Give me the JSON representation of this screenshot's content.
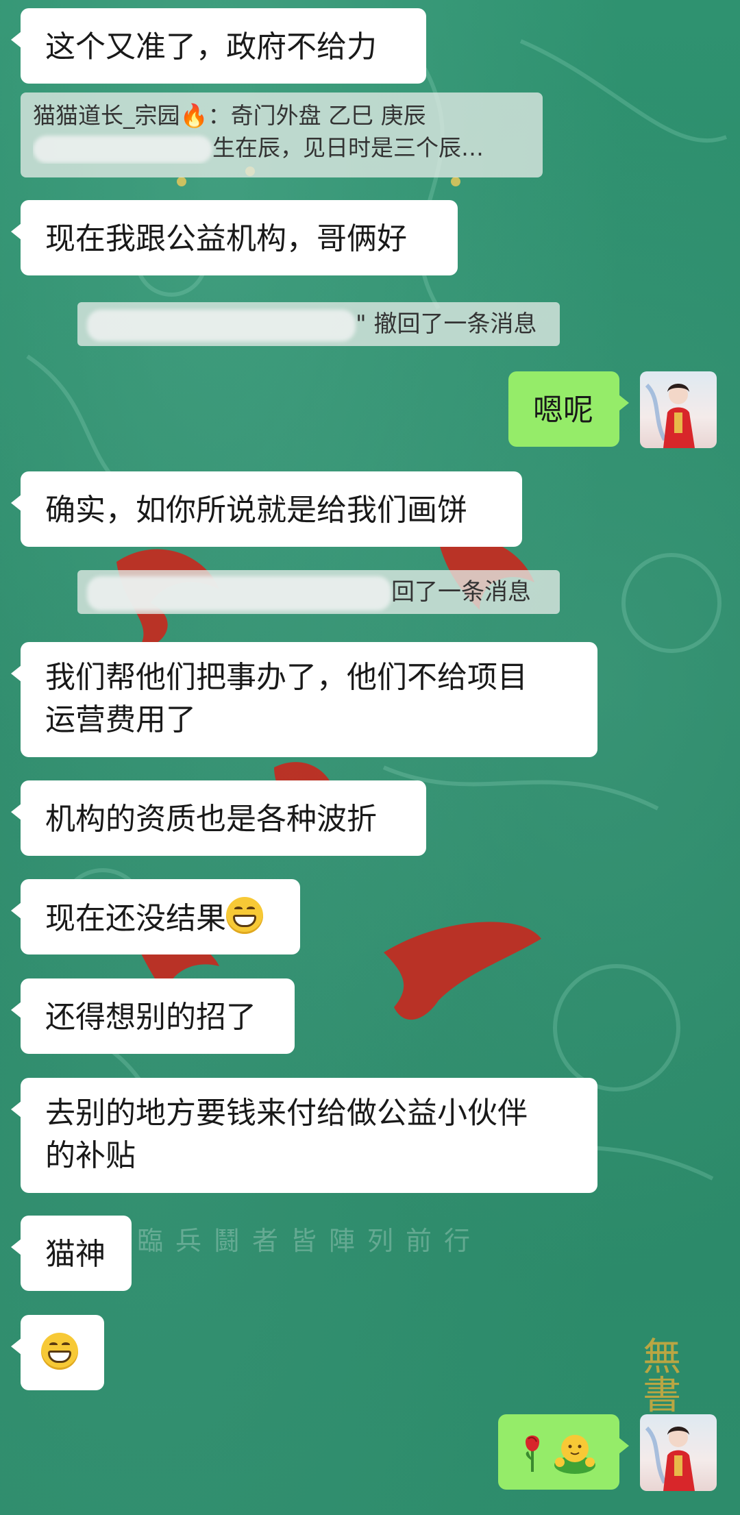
{
  "chat": {
    "messages": [
      {
        "id": "m1",
        "text": "这个又准了，政府不给力"
      },
      {
        "id": "m2",
        "text": "现在我跟公益机构，哥俩好"
      },
      {
        "id": "m3",
        "text": "嗯呢"
      },
      {
        "id": "m4",
        "text": "确实，如你所说就是给我们画饼"
      },
      {
        "id": "m5a",
        "text": "我们帮他们把事办了，他们不给项目"
      },
      {
        "id": "m5b",
        "text": "运营费用了"
      },
      {
        "id": "m6",
        "text": "机构的资质也是各种波折"
      },
      {
        "id": "m7",
        "text": "现在还没结果"
      },
      {
        "id": "m8",
        "text": "还得想别的招了"
      },
      {
        "id": "m9a",
        "text": "去别的地方要钱来付给做公益小伙伴"
      },
      {
        "id": "m9b",
        "text": "的补贴"
      },
      {
        "id": "m10",
        "text": "猫神"
      }
    ],
    "quote": {
      "author": "猫猫道长_宗园",
      "author_suffix": "：奇门外盘  乙巳 庚辰",
      "second_line": "生在辰，见日时是三个辰…"
    },
    "recall_notice_1": "\" 撤回了一条消息",
    "recall_notice_2": "回了一条消息",
    "last_outgoing": {
      "emojis": [
        "rose-emoji",
        "hug-emoji"
      ]
    }
  },
  "background": {
    "text": "臨兵鬪者皆陣列前行",
    "corner_text": "無書"
  },
  "colors": {
    "incoming_bubble": "#ffffff",
    "outgoing_bubble": "#95ec69",
    "background": "#2e8b6c"
  }
}
